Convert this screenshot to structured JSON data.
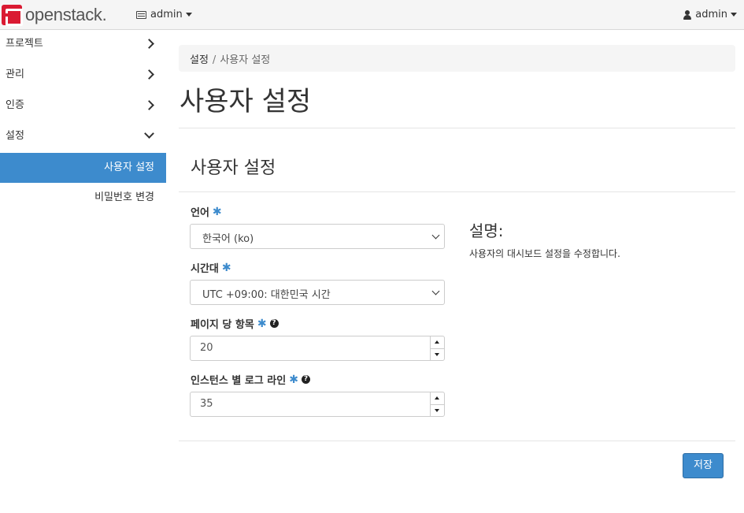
{
  "navbar": {
    "logo_text": "openstack.",
    "project_label": "admin",
    "user_label": "admin"
  },
  "sidebar": {
    "items": [
      {
        "label": "프로젝트",
        "expanded": false
      },
      {
        "label": "관리",
        "expanded": false
      },
      {
        "label": "인증",
        "expanded": false
      },
      {
        "label": "설정",
        "expanded": true
      }
    ],
    "subitems": [
      {
        "label": "사용자 설정",
        "active": true
      },
      {
        "label": "비밀번호 변경",
        "active": false
      }
    ]
  },
  "breadcrumb": {
    "parent": "설정",
    "current": "사용자 설정"
  },
  "page_title": "사용자 설정",
  "form": {
    "title": "사용자 설정",
    "fields": {
      "language": {
        "label": "언어",
        "required_mark": "✱",
        "value": "한국어 (ko)"
      },
      "timezone": {
        "label": "시간대",
        "required_mark": "✱",
        "value": "UTC +09:00: 대한민국 시간"
      },
      "pagesize": {
        "label": "페이지 당 항목",
        "required_mark": "✱",
        "help": "?",
        "value": "20"
      },
      "loglines": {
        "label": "인스턴스 별 로그 라인",
        "required_mark": "✱",
        "help": "?",
        "value": "35"
      }
    },
    "description": {
      "title": "설명:",
      "text": "사용자의 대시보드 설정을 수정합니다."
    },
    "save_label": "저장"
  },
  "colors": {
    "accent": "#3d8bcd",
    "brand": "#da1a32"
  }
}
